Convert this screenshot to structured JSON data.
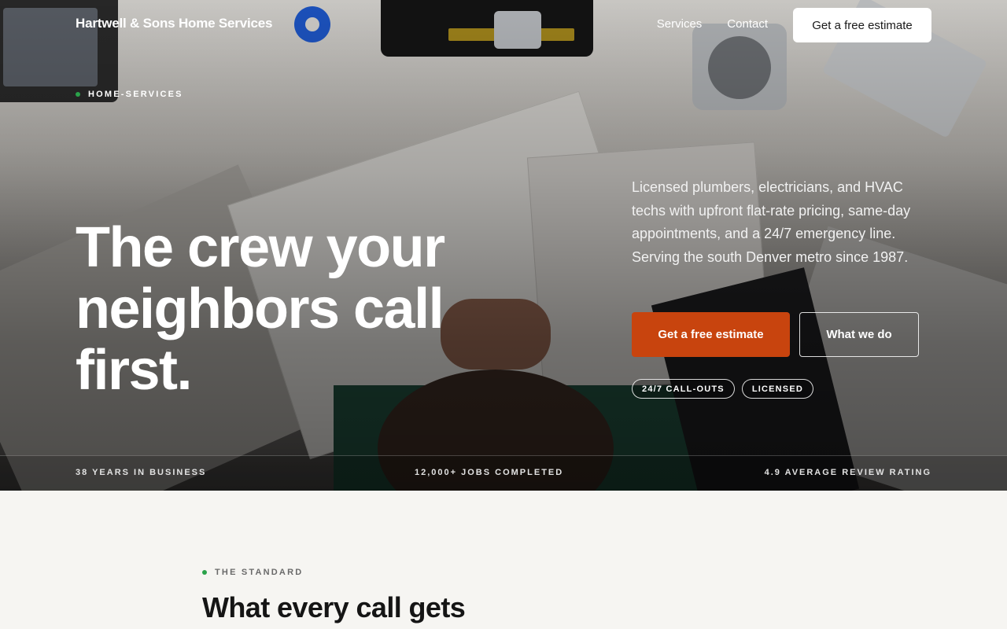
{
  "nav": {
    "brand": "Hartwell & Sons Home Services",
    "links": [
      "Services",
      "Contact"
    ],
    "cta_label": "Get a free estimate"
  },
  "hero": {
    "eyebrow": "HOME-SERVICES",
    "headline": "The crew your neighbors call first.",
    "intro": "Licensed plumbers, electricians, and HVAC techs with upfront flat-rate pricing, same-day appointments, and a 24/7 emergency line. Serving the south Denver metro since 1987.",
    "primary_cta": "Get a free estimate",
    "secondary_cta": "What we do",
    "badges": [
      "24/7 CALL-OUTS",
      "LICENSED"
    ]
  },
  "stats": [
    "38 YEARS IN BUSINESS",
    "12,000+ JOBS COMPLETED",
    "4.9 AVERAGE REVIEW RATING"
  ],
  "standard_section": {
    "eyebrow": "THE STANDARD",
    "title": "What every call gets"
  },
  "colors": {
    "accent": "#c8440e",
    "eyebrow_dot": "#2aa24a",
    "page_background": "#f6f5f2"
  }
}
